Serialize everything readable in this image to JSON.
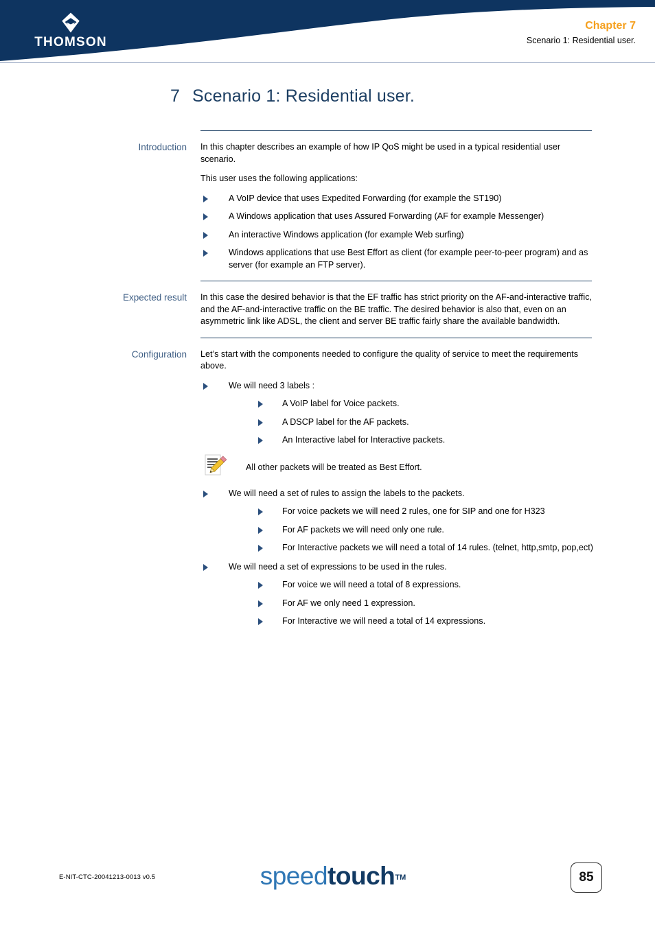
{
  "header": {
    "brand_name": "THOMSON",
    "logo_icon": "thomson-diamond-logo",
    "chapter_label": "Chapter 7",
    "chapter_subtitle": "Scenario 1: Residential user.",
    "band_color": "#0E3460",
    "chapter_color": "#F5A01E"
  },
  "title": {
    "number": "7",
    "text": "Scenario 1: Residential user."
  },
  "sections": {
    "introduction": {
      "label": "Introduction",
      "paragraph_1": "In this chapter describes an example of how IP QoS might be used in a typical residential user scenario.",
      "paragraph_2": "This user uses the following applications:",
      "bullets": [
        "A VoIP device that uses Expedited Forwarding (for example the ST190)",
        "A Windows application that uses Assured Forwarding (AF for example Messenger)",
        "An interactive Windows application (for example Web surfing)",
        "Windows applications that use Best Effort as client (for example peer-to-peer program) and as server (for example an FTP server)."
      ]
    },
    "expected_result": {
      "label": "Expected result",
      "paragraph_1": "In this case the desired behavior is that the EF traffic has strict priority on the AF-and-interactive traffic, and the AF-and-interactive traffic on the BE traffic. The desired behavior is also that, even on an asymmetric link like ADSL, the client and server BE traffic fairly share the available bandwidth."
    },
    "configuration": {
      "label": "Configuration",
      "paragraph_1": "Let’s start with the components needed to configure the quality of service to meet the requirements above.",
      "labels_bullet": "We will need 3 labels :",
      "labels_sub": [
        "A VoIP label for Voice packets.",
        "A DSCP label for the AF packets.",
        "An Interactive label for Interactive packets."
      ],
      "note_icon": "note-pencil-icon",
      "note_text": "All other packets will be treated as Best Effort.",
      "rules_bullet": "We will need a set of rules to assign the labels to the packets.",
      "rules_sub": [
        "For voice packets we will need 2 rules, one for SIP and one for H323",
        "For AF packets we will need only one rule.",
        "For Interactive packets we will need a total of 14 rules. (telnet, http,smtp, pop,ect)"
      ],
      "expressions_bullet": "We will need a set of expressions to be used in the rules.",
      "expressions_sub": [
        "For voice we will need a total of 8 expressions.",
        "For AF we only need 1 expression.",
        "For Interactive we will need a total of 14 expressions."
      ]
    }
  },
  "footer": {
    "doc_code": "E-NIT-CTC-20041213-0013 v0.5",
    "brand_speed": "speed",
    "brand_touch": "touch",
    "brand_tm": "TM",
    "page_number": "85"
  }
}
